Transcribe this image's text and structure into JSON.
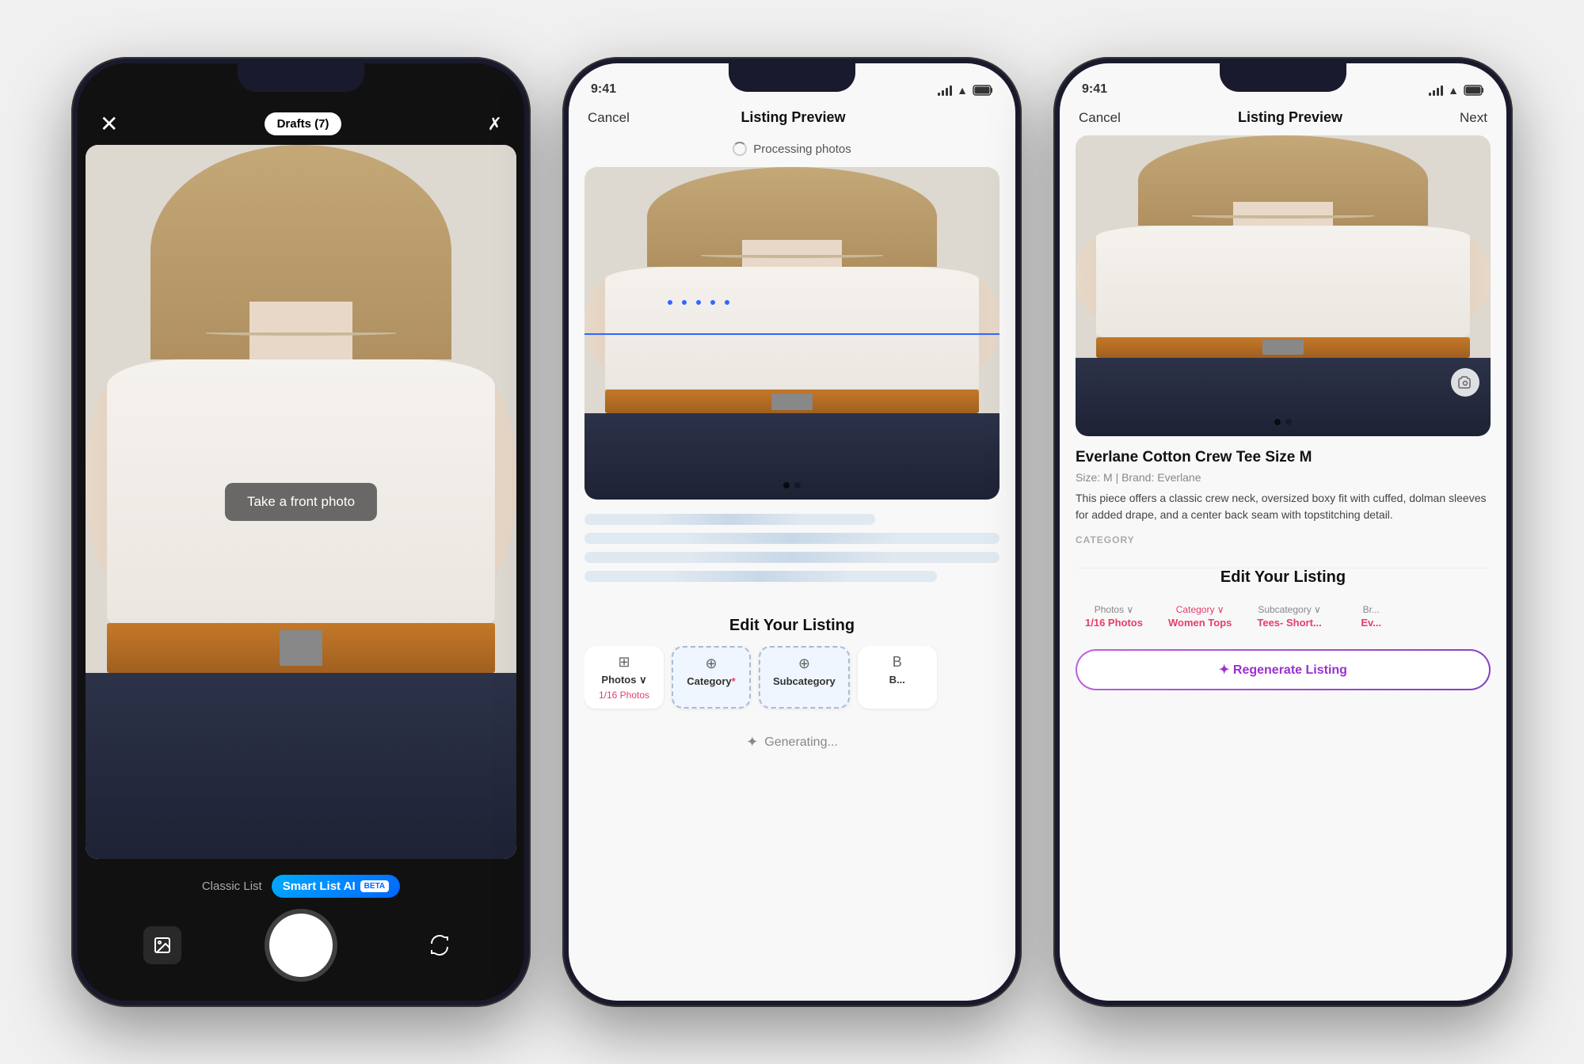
{
  "phone1": {
    "top_bar": {
      "close_label": "✕",
      "drafts_label": "Drafts (7)",
      "x_label": "✕"
    },
    "overlay_text": "Take a front photo",
    "listing_mode": {
      "classic_label": "Classic List",
      "smart_label": "Smart List AI",
      "beta_label": "BETA"
    },
    "camera_controls": {
      "gallery_icon": "⊞",
      "flip_icon": "↺"
    }
  },
  "phone2": {
    "status": {
      "time": "9:41"
    },
    "nav": {
      "cancel_label": "Cancel",
      "title": "Listing Preview",
      "next_label": ""
    },
    "processing_label": "Processing photos",
    "edit_listing_title": "Edit Your Listing",
    "tabs": [
      {
        "icon": "⊕",
        "label": "Photos",
        "sublabel": "1/16 Photos",
        "required": false,
        "selected": false
      },
      {
        "icon": "⊕",
        "label": "Category",
        "sublabel": "",
        "required": true,
        "selected": true
      },
      {
        "icon": "⊕",
        "label": "Subcategory",
        "sublabel": "",
        "required": false,
        "selected": true
      },
      {
        "icon": "B",
        "label": "Brand",
        "sublabel": "",
        "required": false,
        "selected": false
      }
    ],
    "generating_label": "Generating..."
  },
  "phone3": {
    "status": {
      "time": "9:41"
    },
    "nav": {
      "cancel_label": "Cancel",
      "title": "Listing Preview",
      "next_label": "Next"
    },
    "product": {
      "title": "Everlane Cotton Crew Tee Size M",
      "meta": "Size: M  |  Brand: Everlane",
      "description": "This piece offers a classic crew neck, oversized boxy fit with cuffed, dolman sleeves for added drape, and a center back seam with topstitching detail.",
      "category_label": "CATEGORY"
    },
    "edit_listing_title": "Edit Your Listing",
    "tabs": [
      {
        "label": "Photos",
        "sublabel": "1/16 Photos",
        "active": false
      },
      {
        "label": "Category",
        "sublabel": "Women Tops",
        "active": true
      },
      {
        "label": "Subcategory",
        "sublabel": "Tees- Short...",
        "active": false
      },
      {
        "label": "Brand",
        "sublabel": "Ev...",
        "active": false
      }
    ],
    "regenerate_label": "✦ Regenerate Listing"
  }
}
